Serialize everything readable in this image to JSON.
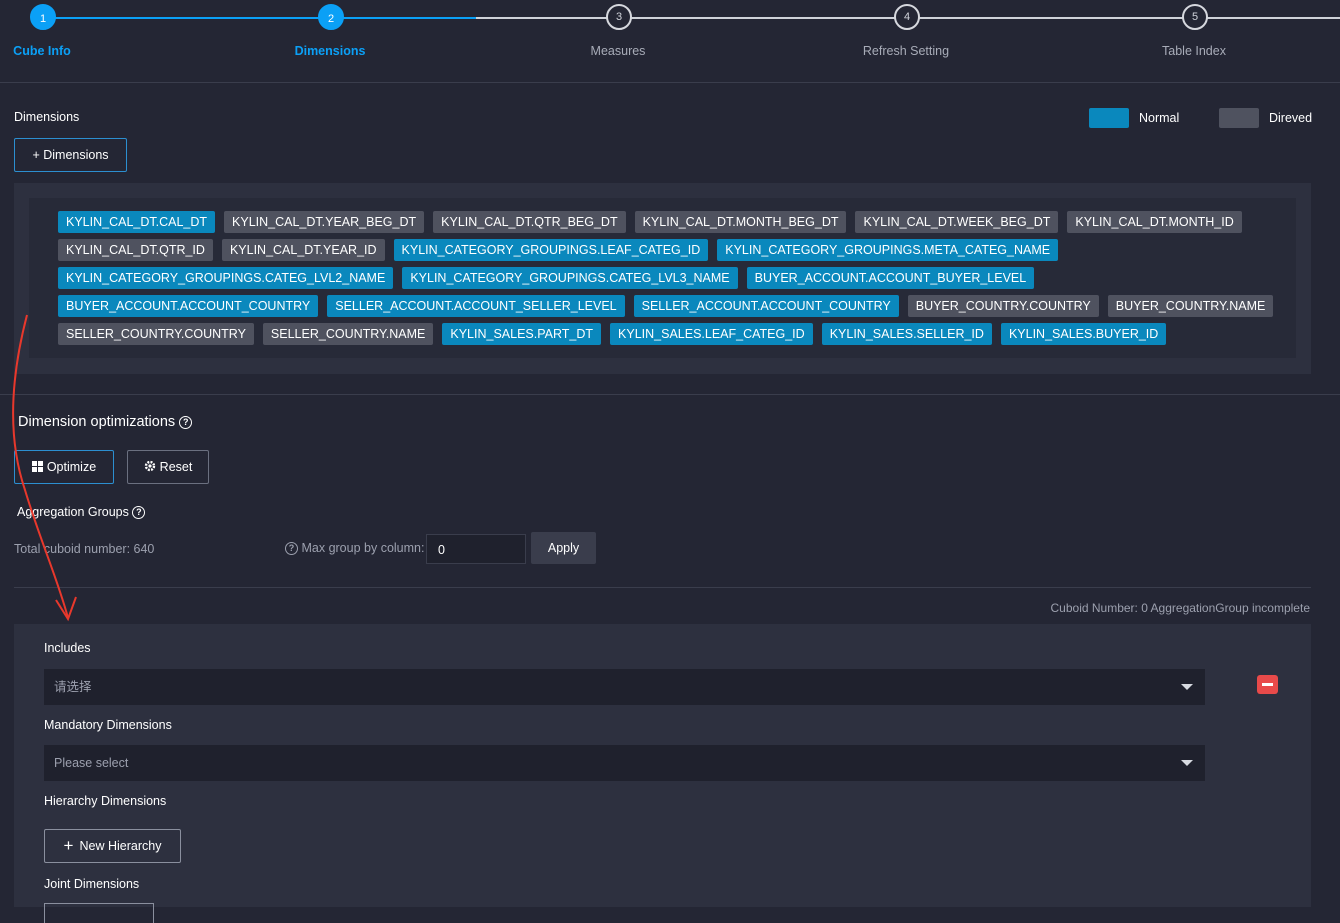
{
  "steps": [
    {
      "num": "1",
      "label": "Cube Info",
      "active": true
    },
    {
      "num": "2",
      "label": "Dimensions",
      "active": true
    },
    {
      "num": "3",
      "label": "Measures",
      "active": false
    },
    {
      "num": "4",
      "label": "Refresh Setting",
      "active": false
    },
    {
      "num": "5",
      "label": "Table Index",
      "active": false
    }
  ],
  "dimensions": {
    "title": "Dimensions",
    "add_button": "+ Dimensions",
    "legend": {
      "normal": "Normal",
      "derived": "Direved",
      "normal_color": "#0a88bd",
      "derived_color": "#4f525f"
    },
    "tags": [
      {
        "text": "KYLIN_CAL_DT.CAL_DT",
        "type": "normal"
      },
      {
        "text": "KYLIN_CAL_DT.YEAR_BEG_DT",
        "type": "derived"
      },
      {
        "text": "KYLIN_CAL_DT.QTR_BEG_DT",
        "type": "derived"
      },
      {
        "text": "KYLIN_CAL_DT.MONTH_BEG_DT",
        "type": "derived"
      },
      {
        "text": "KYLIN_CAL_DT.WEEK_BEG_DT",
        "type": "derived"
      },
      {
        "text": "KYLIN_CAL_DT.MONTH_ID",
        "type": "derived"
      },
      {
        "text": "KYLIN_CAL_DT.QTR_ID",
        "type": "derived"
      },
      {
        "text": "KYLIN_CAL_DT.YEAR_ID",
        "type": "derived"
      },
      {
        "text": "KYLIN_CATEGORY_GROUPINGS.LEAF_CATEG_ID",
        "type": "normal"
      },
      {
        "text": "KYLIN_CATEGORY_GROUPINGS.META_CATEG_NAME",
        "type": "normal"
      },
      {
        "text": "KYLIN_CATEGORY_GROUPINGS.CATEG_LVL2_NAME",
        "type": "normal"
      },
      {
        "text": "KYLIN_CATEGORY_GROUPINGS.CATEG_LVL3_NAME",
        "type": "normal"
      },
      {
        "text": "BUYER_ACCOUNT.ACCOUNT_BUYER_LEVEL",
        "type": "normal"
      },
      {
        "text": "BUYER_ACCOUNT.ACCOUNT_COUNTRY",
        "type": "normal"
      },
      {
        "text": "SELLER_ACCOUNT.ACCOUNT_SELLER_LEVEL",
        "type": "normal"
      },
      {
        "text": "SELLER_ACCOUNT.ACCOUNT_COUNTRY",
        "type": "normal"
      },
      {
        "text": "BUYER_COUNTRY.COUNTRY",
        "type": "derived"
      },
      {
        "text": "BUYER_COUNTRY.NAME",
        "type": "derived"
      },
      {
        "text": "SELLER_COUNTRY.COUNTRY",
        "type": "derived"
      },
      {
        "text": "SELLER_COUNTRY.NAME",
        "type": "derived"
      },
      {
        "text": "KYLIN_SALES.PART_DT",
        "type": "normal"
      },
      {
        "text": "KYLIN_SALES.LEAF_CATEG_ID",
        "type": "normal"
      },
      {
        "text": "KYLIN_SALES.SELLER_ID",
        "type": "normal"
      },
      {
        "text": "KYLIN_SALES.BUYER_ID",
        "type": "normal"
      }
    ]
  },
  "optimizations": {
    "title": "Dimension optimizations",
    "optimize_button": "Optimize",
    "reset_button": "Reset",
    "agg_groups_label": "Aggregation Groups",
    "total_cuboid": "Total cuboid number: 640",
    "max_group_label": "Max group by column:",
    "max_group_value": "0",
    "apply_button": "Apply",
    "cuboid_status": "Cuboid Number: 0 AggregationGroup incomplete"
  },
  "agg_group": {
    "includes_label": "Includes",
    "includes_placeholder": "请选择",
    "mandatory_label": "Mandatory Dimensions",
    "mandatory_placeholder": "Please select",
    "hierarchy_label": "Hierarchy Dimensions",
    "new_hierarchy_button": "New Hierarchy",
    "joint_label": "Joint Dimensions"
  },
  "colors": {
    "accent": "#0ba0f6",
    "remove": "#e84a4a",
    "annotation": "#e8382c"
  }
}
